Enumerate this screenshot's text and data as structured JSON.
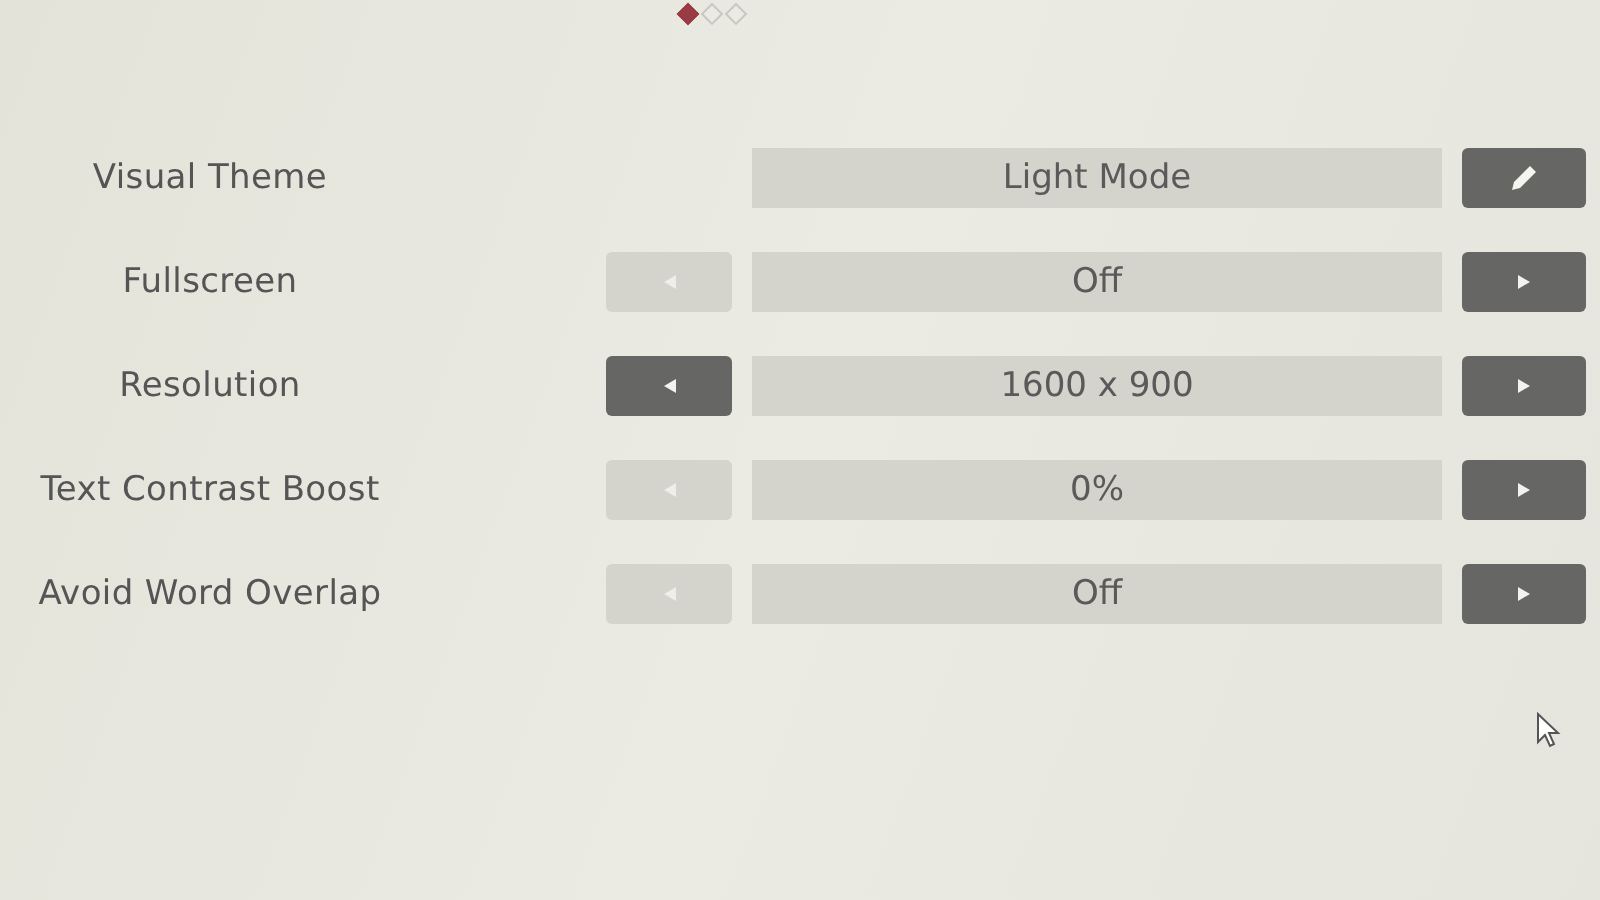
{
  "pager": [
    {
      "selected": true
    },
    {
      "selected": false
    },
    {
      "selected": false
    }
  ],
  "settings": [
    {
      "kind": "edit",
      "label": "Visual Theme",
      "value": "Light Mode"
    },
    {
      "kind": "cycle",
      "label": "Fullscreen",
      "value": "Off",
      "prev_disabled": true,
      "next_disabled": false
    },
    {
      "kind": "cycle",
      "label": "Resolution",
      "value": "1600 x 900",
      "prev_disabled": false,
      "next_disabled": false
    },
    {
      "kind": "cycle",
      "label": "Text Contrast Boost",
      "value": "0%",
      "prev_disabled": true,
      "next_disabled": false
    },
    {
      "kind": "cycle",
      "label": "Avoid Word Overlap",
      "value": "Off",
      "prev_disabled": true,
      "next_disabled": false
    }
  ]
}
